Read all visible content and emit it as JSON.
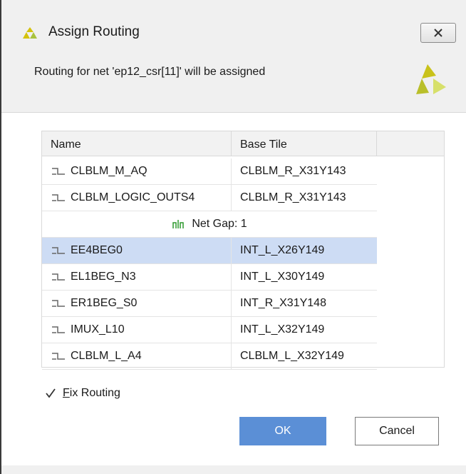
{
  "window": {
    "title": "Assign Routing",
    "close_icon": "close-icon"
  },
  "header": {
    "message": "Routing for net 'ep12_csr[11]' will be assigned"
  },
  "table": {
    "columns": [
      "Name",
      "Base Tile"
    ],
    "rows_before_gap": [
      {
        "name": "CLBLM_M_AQ",
        "tile": "CLBLM_R_X31Y143"
      },
      {
        "name": "CLBLM_LOGIC_OUTS4",
        "tile": "CLBLM_R_X31Y143"
      }
    ],
    "gap_label": "Net Gap: 1",
    "rows_after_gap": [
      {
        "name": "EE4BEG0",
        "tile": "INT_L_X26Y149",
        "selected": true
      },
      {
        "name": "EL1BEG_N3",
        "tile": "INT_L_X30Y149"
      },
      {
        "name": "ER1BEG_S0",
        "tile": "INT_R_X31Y148"
      },
      {
        "name": "IMUX_L10",
        "tile": "INT_L_X32Y149"
      },
      {
        "name": "CLBLM_L_A4",
        "tile": "CLBLM_L_X32Y149"
      }
    ]
  },
  "options": {
    "fix_routing_mnemonic": "F",
    "fix_routing_rest": "ix Routing",
    "fix_routing_checked": true
  },
  "buttons": {
    "ok": "OK",
    "cancel": "Cancel"
  },
  "colors": {
    "ok_button": "#5b8fd6",
    "selected_row": "#cddcf4",
    "logo_yellow": "#d6d63a"
  }
}
